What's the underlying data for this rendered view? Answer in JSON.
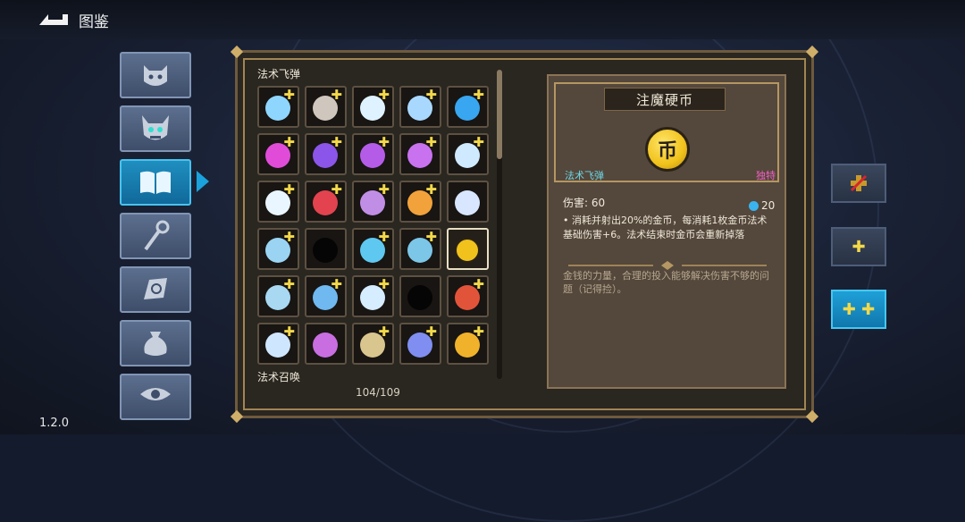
{
  "header": {
    "title": "图鉴",
    "back_icon": "back-arrow-icon"
  },
  "version": "1.2.0",
  "sidebar": {
    "tabs": [
      {
        "icon": "monster-face-icon",
        "active": false
      },
      {
        "icon": "boss-horned-face-icon",
        "active": false
      },
      {
        "icon": "open-book-icon",
        "active": true
      },
      {
        "icon": "staff-icon",
        "active": false
      },
      {
        "icon": "relic-hand-icon",
        "active": false
      },
      {
        "icon": "pouch-icon",
        "active": false
      },
      {
        "icon": "eye-icon",
        "active": false
      }
    ]
  },
  "catalog": {
    "section_spell_missile": "法术飞弹",
    "section_spell_summon": "法术召唤",
    "count": "104/109",
    "cells": [
      {
        "icon": "frost-orb-icon",
        "color": "#8fd6ff",
        "plus": "✚"
      },
      {
        "icon": "stone-ball-icon",
        "color": "#cfc7bd",
        "plus": "✚"
      },
      {
        "icon": "butterfly-icon",
        "color": "#dff2ff",
        "plus": "✚"
      },
      {
        "icon": "light-lance-icon",
        "color": "#a9d8ff",
        "plus": "✚"
      },
      {
        "icon": "spiral-square-icon",
        "color": "#38a6f0",
        "plus": "✚"
      },
      {
        "icon": "pink-bolt-icon",
        "color": "#e04cd8",
        "plus": "✚"
      },
      {
        "icon": "vortex-icon",
        "color": "#8a55e8",
        "plus": "✚"
      },
      {
        "icon": "purple-orb-icon",
        "color": "#b45ce8",
        "plus": "✚"
      },
      {
        "icon": "cross-arrows-icon",
        "color": "#c872f0",
        "plus": "✚"
      },
      {
        "icon": "ice-shard-icon",
        "color": "#cfe9ff",
        "plus": "✚"
      },
      {
        "icon": "frost-blade-icon",
        "color": "#eaf6ff",
        "plus": "✚"
      },
      {
        "icon": "red-orb-icon",
        "color": "#e2434f",
        "plus": "✚"
      },
      {
        "icon": "violet-gem-icon",
        "color": "#c18ee6",
        "plus": "✚"
      },
      {
        "icon": "rainbow-icon",
        "color": "#f2a23a",
        "plus": "✚"
      },
      {
        "icon": "sparkle-icon",
        "color": "#d8e6ff",
        "plus": ""
      },
      {
        "icon": "ice-fist-icon",
        "color": "#9ad4f2",
        "plus": "✚"
      },
      {
        "icon": "locked-silhouette-icon",
        "color": "#050505",
        "plus": ""
      },
      {
        "icon": "lightning-icon",
        "color": "#5ec8f0",
        "plus": "✚"
      },
      {
        "icon": "wave-icon",
        "color": "#7cc6e8",
        "plus": "✚"
      },
      {
        "icon": "gold-coin-icon",
        "color": "#f0c21b",
        "plus": ""
      },
      {
        "icon": "frost-claw-icon",
        "color": "#a8d8f2",
        "plus": "✚"
      },
      {
        "icon": "crescent-icon",
        "color": "#6fb8f0",
        "plus": "✚"
      },
      {
        "icon": "crossed-swords-icon",
        "color": "#d6ecff",
        "plus": "✚"
      },
      {
        "icon": "locked-silhouette-icon",
        "color": "#050505",
        "plus": ""
      },
      {
        "icon": "flame-leaf-icon",
        "color": "#e2543a",
        "plus": "✚"
      },
      {
        "icon": "ice-spear-icon",
        "color": "#cfe6ff",
        "plus": "✚"
      },
      {
        "icon": "pentagram-icon",
        "color": "#c86ee0",
        "plus": ""
      },
      {
        "icon": "arrow-icon",
        "color": "#d9c58e",
        "plus": "✚"
      },
      {
        "icon": "comet-icon",
        "color": "#7f8ef0",
        "plus": "✚"
      },
      {
        "icon": "golden-feathers-icon",
        "color": "#f0b22a",
        "plus": "✚"
      }
    ]
  },
  "detail": {
    "name": "注魔硬币",
    "coin_glyph": "币",
    "type": "法术飞弹",
    "rarity": "独特",
    "damage": "伤害: 60",
    "cost": "20",
    "description": "• 消耗并射出20%的金币，每消耗1枚金币法术基础伤害+6。法术结束时金币会重新掉落",
    "flavor": "金钱的力量，合理的投入能够解决伤害不够的问题（记得捡）。"
  },
  "upgrades": [
    {
      "label": "",
      "icon": "disabled-upgrade-icon",
      "active": false
    },
    {
      "label": "✚",
      "icon": "plus-icon",
      "active": false
    },
    {
      "label": "✚ ✚",
      "icon": "double-plus-icon",
      "active": true
    }
  ],
  "colors": {
    "accent": "#1aa2dc",
    "panel": "#54473b",
    "gold": "#f3d84a"
  }
}
